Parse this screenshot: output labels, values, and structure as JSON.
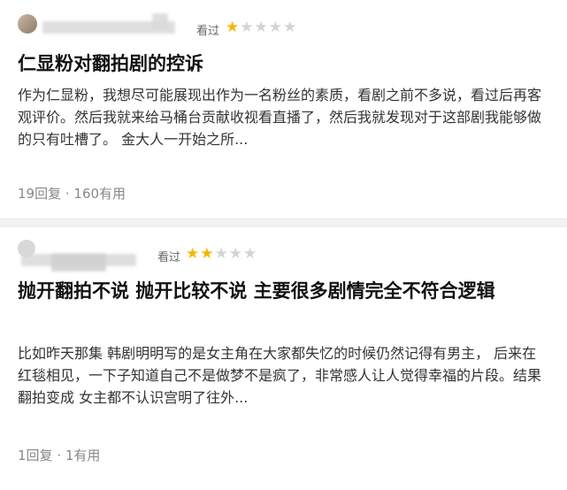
{
  "reviews": [
    {
      "status": "看过",
      "rating": 1,
      "max_rating": 5,
      "title": "仁显粉对翻拍剧的控诉",
      "body": "作为仁显粉，我想尽可能展现出作为一名粉丝的素质，看剧之前不多说，看过后再客观评价。然后我就来给马桶台贡献收视看直播了，然后我就发现对于这部剧我能够做的只有吐槽了。 金大人一开始之所...",
      "replies": "19回复",
      "useful": "160有用"
    },
    {
      "status": "看过",
      "rating": 2,
      "max_rating": 5,
      "title": "抛开翻拍不说 抛开比较不说 主要很多剧情完全不符合逻辑",
      "body": "比如昨天那集 韩剧明明写的是女主角在大家都失忆的时候仍然记得有男主， 后来在红毯相见，一下子知道自己不是做梦不是疯了，非常感人让人觉得幸福的片段。结果翻拍变成 女主都不认识宫明了往外...",
      "replies": "1回复",
      "useful": "1有用"
    }
  ],
  "meta_separator": " · ",
  "colors": {
    "star_on": "#f7b500",
    "star_off": "#d3d3d3"
  }
}
